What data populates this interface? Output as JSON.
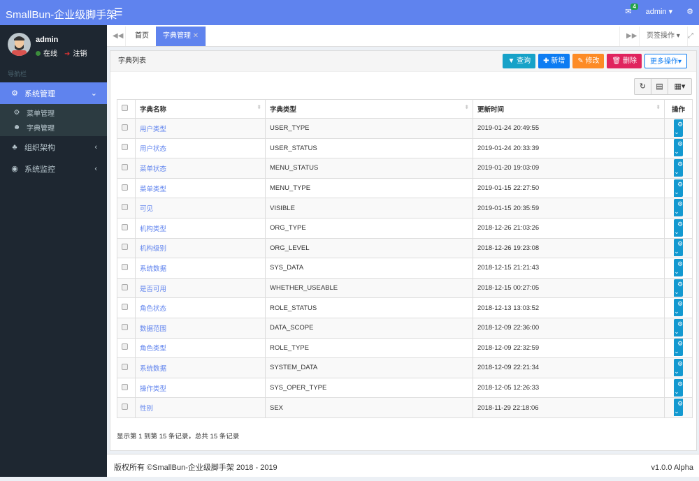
{
  "header": {
    "logo": "SmallBun-企业级脚手架",
    "mail_badge": "4",
    "user": "admin ▾"
  },
  "user": {
    "name": "admin",
    "online": "在线",
    "logout": "注销"
  },
  "nav_label": "导航栏",
  "menu": {
    "system": "系统管理",
    "sub": [
      "菜单管理",
      "字典管理"
    ],
    "org": "组织架构",
    "monitor": "系统监控"
  },
  "tabs": {
    "home": "首页",
    "active": "字典管理",
    "tab_ops": "页签操作 ▾"
  },
  "panel": {
    "title": "字典列表",
    "buttons": {
      "query": "查询",
      "add": "新增",
      "edit": "修改",
      "delete": "删除",
      "more": "更多操作▾"
    }
  },
  "columns": [
    "字典名称",
    "字典类型",
    "更新时间",
    "操作"
  ],
  "colors": {
    "accent": "#5f83ee",
    "query": "#17a2c8",
    "add": "#0d7cf2",
    "edit": "#fd8b25",
    "delete": "#e0245e"
  },
  "rows": [
    [
      "用户类型",
      "USER_TYPE",
      "2019-01-24 20:49:55"
    ],
    [
      "用户状态",
      "USER_STATUS",
      "2019-01-24 20:33:39"
    ],
    [
      "菜单状态",
      "MENU_STATUS",
      "2019-01-20 19:03:09"
    ],
    [
      "菜单类型",
      "MENU_TYPE",
      "2019-01-15 22:27:50"
    ],
    [
      "可见",
      "VISIBLE",
      "2019-01-15 20:35:59"
    ],
    [
      "机构类型",
      "ORG_TYPE",
      "2018-12-26 21:03:26"
    ],
    [
      "机构级别",
      "ORG_LEVEL",
      "2018-12-26 19:23:08"
    ],
    [
      "系统数据",
      "SYS_DATA",
      "2018-12-15 21:21:43"
    ],
    [
      "是否可用",
      "WHETHER_USEABLE",
      "2018-12-15 00:27:05"
    ],
    [
      "角色状态",
      "ROLE_STATUS",
      "2018-12-13 13:03:52"
    ],
    [
      "数据范围",
      "DATA_SCOPE",
      "2018-12-09 22:36:00"
    ],
    [
      "角色类型",
      "ROLE_TYPE",
      "2018-12-09 22:32:59"
    ],
    [
      "系统数据",
      "SYSTEM_DATA",
      "2018-12-09 22:21:34"
    ],
    [
      "操作类型",
      "SYS_OPER_TYPE",
      "2018-12-05 12:26:33"
    ],
    [
      "性别",
      "SEX",
      "2018-11-29 22:18:06"
    ]
  ],
  "summary": "显示第 1 到第 15 条记录，总共 15 条记录",
  "footer": {
    "copyright": "版权所有 ©SmallBun-企业级脚手架 2018 - 2019",
    "version": "v1.0.0 Alpha"
  }
}
